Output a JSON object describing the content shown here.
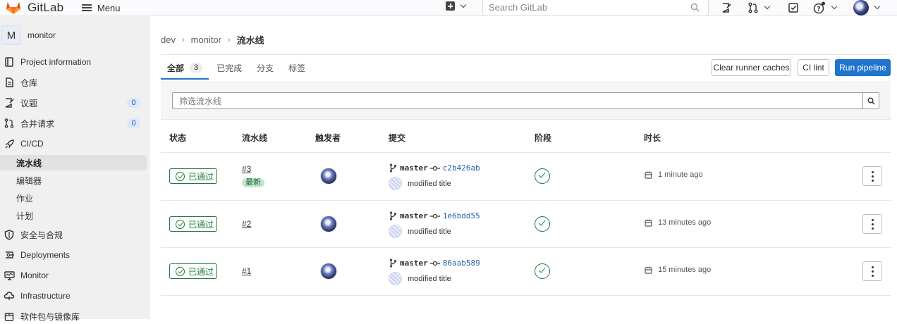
{
  "topbar": {
    "brand": "GitLab",
    "menu_label": "Menu",
    "search_placeholder": "Search GitLab"
  },
  "sidebar": {
    "project_initial": "M",
    "project_name": "monitor",
    "items": [
      {
        "label": "Project information",
        "icon": "information-icon"
      },
      {
        "label": "仓库",
        "icon": "repository-icon"
      },
      {
        "label": "议题",
        "icon": "issues-icon",
        "badge": "0"
      },
      {
        "label": "合并请求",
        "icon": "merge-request-icon",
        "badge": "0"
      },
      {
        "label": "CI/CD",
        "icon": "rocket-icon"
      }
    ],
    "cicd_sub": [
      "流水线",
      "编辑器",
      "作业",
      "计划"
    ],
    "items_after": [
      {
        "label": "安全与合规",
        "icon": "shield-icon"
      },
      {
        "label": "Deployments",
        "icon": "deployments-icon"
      },
      {
        "label": "Monitor",
        "icon": "monitor-icon"
      },
      {
        "label": "Infrastructure",
        "icon": "cloud-icon"
      },
      {
        "label": "软件包与镜像库",
        "icon": "package-icon"
      }
    ]
  },
  "breadcrumb": [
    "dev",
    "monitor",
    "流水线"
  ],
  "tabs": [
    {
      "label": "全部",
      "count": "3"
    },
    {
      "label": "已完成"
    },
    {
      "label": "分支"
    },
    {
      "label": "标签"
    }
  ],
  "buttons": {
    "clear_caches": "Clear runner caches",
    "ci_lint": "CI lint",
    "run_pipeline": "Run pipeline"
  },
  "filter": {
    "placeholder": "筛选流水线"
  },
  "table": {
    "headers": [
      "状态",
      "流水线",
      "触发者",
      "提交",
      "阶段",
      "时长"
    ],
    "rows": [
      {
        "status": "已通过",
        "id": "#3",
        "latest": "最新",
        "branch": "master",
        "sha": "c2b426ab",
        "message": "modified title",
        "duration": "1 minute ago"
      },
      {
        "status": "已通过",
        "id": "#2",
        "branch": "master",
        "sha": "1e6bdd55",
        "message": "modified title",
        "duration": "13 minutes ago"
      },
      {
        "status": "已通过",
        "id": "#1",
        "branch": "master",
        "sha": "86aab589",
        "message": "modified title",
        "duration": "15 minutes ago"
      }
    ]
  },
  "colors": {
    "accent": "#1f75cb",
    "success": "#1f7a3a",
    "brand_orange": "#e24329"
  }
}
